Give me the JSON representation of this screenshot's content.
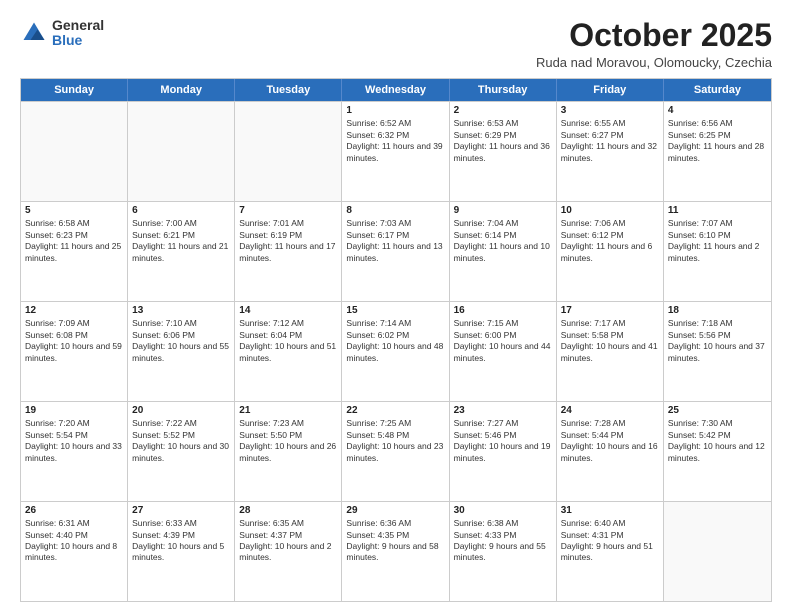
{
  "logo": {
    "general": "General",
    "blue": "Blue"
  },
  "header": {
    "month": "October 2025",
    "location": "Ruda nad Moravou, Olomoucky, Czechia"
  },
  "days": [
    "Sunday",
    "Monday",
    "Tuesday",
    "Wednesday",
    "Thursday",
    "Friday",
    "Saturday"
  ],
  "weeks": [
    [
      {
        "day": "",
        "empty": true
      },
      {
        "day": "",
        "empty": true
      },
      {
        "day": "",
        "empty": true
      },
      {
        "day": "1",
        "rise": "Sunrise: 6:52 AM",
        "set": "Sunset: 6:32 PM",
        "daylight": "Daylight: 11 hours and 39 minutes."
      },
      {
        "day": "2",
        "rise": "Sunrise: 6:53 AM",
        "set": "Sunset: 6:29 PM",
        "daylight": "Daylight: 11 hours and 36 minutes."
      },
      {
        "day": "3",
        "rise": "Sunrise: 6:55 AM",
        "set": "Sunset: 6:27 PM",
        "daylight": "Daylight: 11 hours and 32 minutes."
      },
      {
        "day": "4",
        "rise": "Sunrise: 6:56 AM",
        "set": "Sunset: 6:25 PM",
        "daylight": "Daylight: 11 hours and 28 minutes."
      }
    ],
    [
      {
        "day": "5",
        "rise": "Sunrise: 6:58 AM",
        "set": "Sunset: 6:23 PM",
        "daylight": "Daylight: 11 hours and 25 minutes."
      },
      {
        "day": "6",
        "rise": "Sunrise: 7:00 AM",
        "set": "Sunset: 6:21 PM",
        "daylight": "Daylight: 11 hours and 21 minutes."
      },
      {
        "day": "7",
        "rise": "Sunrise: 7:01 AM",
        "set": "Sunset: 6:19 PM",
        "daylight": "Daylight: 11 hours and 17 minutes."
      },
      {
        "day": "8",
        "rise": "Sunrise: 7:03 AM",
        "set": "Sunset: 6:17 PM",
        "daylight": "Daylight: 11 hours and 13 minutes."
      },
      {
        "day": "9",
        "rise": "Sunrise: 7:04 AM",
        "set": "Sunset: 6:14 PM",
        "daylight": "Daylight: 11 hours and 10 minutes."
      },
      {
        "day": "10",
        "rise": "Sunrise: 7:06 AM",
        "set": "Sunset: 6:12 PM",
        "daylight": "Daylight: 11 hours and 6 minutes."
      },
      {
        "day": "11",
        "rise": "Sunrise: 7:07 AM",
        "set": "Sunset: 6:10 PM",
        "daylight": "Daylight: 11 hours and 2 minutes."
      }
    ],
    [
      {
        "day": "12",
        "rise": "Sunrise: 7:09 AM",
        "set": "Sunset: 6:08 PM",
        "daylight": "Daylight: 10 hours and 59 minutes."
      },
      {
        "day": "13",
        "rise": "Sunrise: 7:10 AM",
        "set": "Sunset: 6:06 PM",
        "daylight": "Daylight: 10 hours and 55 minutes."
      },
      {
        "day": "14",
        "rise": "Sunrise: 7:12 AM",
        "set": "Sunset: 6:04 PM",
        "daylight": "Daylight: 10 hours and 51 minutes."
      },
      {
        "day": "15",
        "rise": "Sunrise: 7:14 AM",
        "set": "Sunset: 6:02 PM",
        "daylight": "Daylight: 10 hours and 48 minutes."
      },
      {
        "day": "16",
        "rise": "Sunrise: 7:15 AM",
        "set": "Sunset: 6:00 PM",
        "daylight": "Daylight: 10 hours and 44 minutes."
      },
      {
        "day": "17",
        "rise": "Sunrise: 7:17 AM",
        "set": "Sunset: 5:58 PM",
        "daylight": "Daylight: 10 hours and 41 minutes."
      },
      {
        "day": "18",
        "rise": "Sunrise: 7:18 AM",
        "set": "Sunset: 5:56 PM",
        "daylight": "Daylight: 10 hours and 37 minutes."
      }
    ],
    [
      {
        "day": "19",
        "rise": "Sunrise: 7:20 AM",
        "set": "Sunset: 5:54 PM",
        "daylight": "Daylight: 10 hours and 33 minutes."
      },
      {
        "day": "20",
        "rise": "Sunrise: 7:22 AM",
        "set": "Sunset: 5:52 PM",
        "daylight": "Daylight: 10 hours and 30 minutes."
      },
      {
        "day": "21",
        "rise": "Sunrise: 7:23 AM",
        "set": "Sunset: 5:50 PM",
        "daylight": "Daylight: 10 hours and 26 minutes."
      },
      {
        "day": "22",
        "rise": "Sunrise: 7:25 AM",
        "set": "Sunset: 5:48 PM",
        "daylight": "Daylight: 10 hours and 23 minutes."
      },
      {
        "day": "23",
        "rise": "Sunrise: 7:27 AM",
        "set": "Sunset: 5:46 PM",
        "daylight": "Daylight: 10 hours and 19 minutes."
      },
      {
        "day": "24",
        "rise": "Sunrise: 7:28 AM",
        "set": "Sunset: 5:44 PM",
        "daylight": "Daylight: 10 hours and 16 minutes."
      },
      {
        "day": "25",
        "rise": "Sunrise: 7:30 AM",
        "set": "Sunset: 5:42 PM",
        "daylight": "Daylight: 10 hours and 12 minutes."
      }
    ],
    [
      {
        "day": "26",
        "rise": "Sunrise: 6:31 AM",
        "set": "Sunset: 4:40 PM",
        "daylight": "Daylight: 10 hours and 8 minutes."
      },
      {
        "day": "27",
        "rise": "Sunrise: 6:33 AM",
        "set": "Sunset: 4:39 PM",
        "daylight": "Daylight: 10 hours and 5 minutes."
      },
      {
        "day": "28",
        "rise": "Sunrise: 6:35 AM",
        "set": "Sunset: 4:37 PM",
        "daylight": "Daylight: 10 hours and 2 minutes."
      },
      {
        "day": "29",
        "rise": "Sunrise: 6:36 AM",
        "set": "Sunset: 4:35 PM",
        "daylight": "Daylight: 9 hours and 58 minutes."
      },
      {
        "day": "30",
        "rise": "Sunrise: 6:38 AM",
        "set": "Sunset: 4:33 PM",
        "daylight": "Daylight: 9 hours and 55 minutes."
      },
      {
        "day": "31",
        "rise": "Sunrise: 6:40 AM",
        "set": "Sunset: 4:31 PM",
        "daylight": "Daylight: 9 hours and 51 minutes."
      },
      {
        "day": "",
        "empty": true
      }
    ]
  ]
}
